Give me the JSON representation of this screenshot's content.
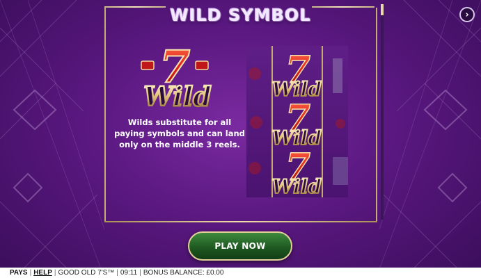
{
  "title": "WILD SYMBOL",
  "wild_logo": {
    "seven": "7",
    "word": "Wild"
  },
  "description": [
    "Wilds substitute for all",
    "paying symbols and can land",
    "only on the middle 3 reels."
  ],
  "reels": {
    "wild_stack": [
      {
        "seven": "7",
        "word": "Wild"
      },
      {
        "seven": "7",
        "word": "Wild"
      },
      {
        "seven": "7",
        "word": "Wild"
      }
    ]
  },
  "play_button": "PLAY NOW",
  "status_bar": {
    "pays": "PAYS",
    "help": "HELP",
    "game_name": "GOOD OLD 7'S™",
    "time": "09:11",
    "bonus_balance": "BONUS BALANCE: £0.00"
  },
  "colors": {
    "background": "#5a1880",
    "gold": "#c5ad74",
    "seven_red": "#e0231b",
    "play_green": "#1f5a22"
  },
  "icons": {
    "next": "chevron-right-icon"
  }
}
